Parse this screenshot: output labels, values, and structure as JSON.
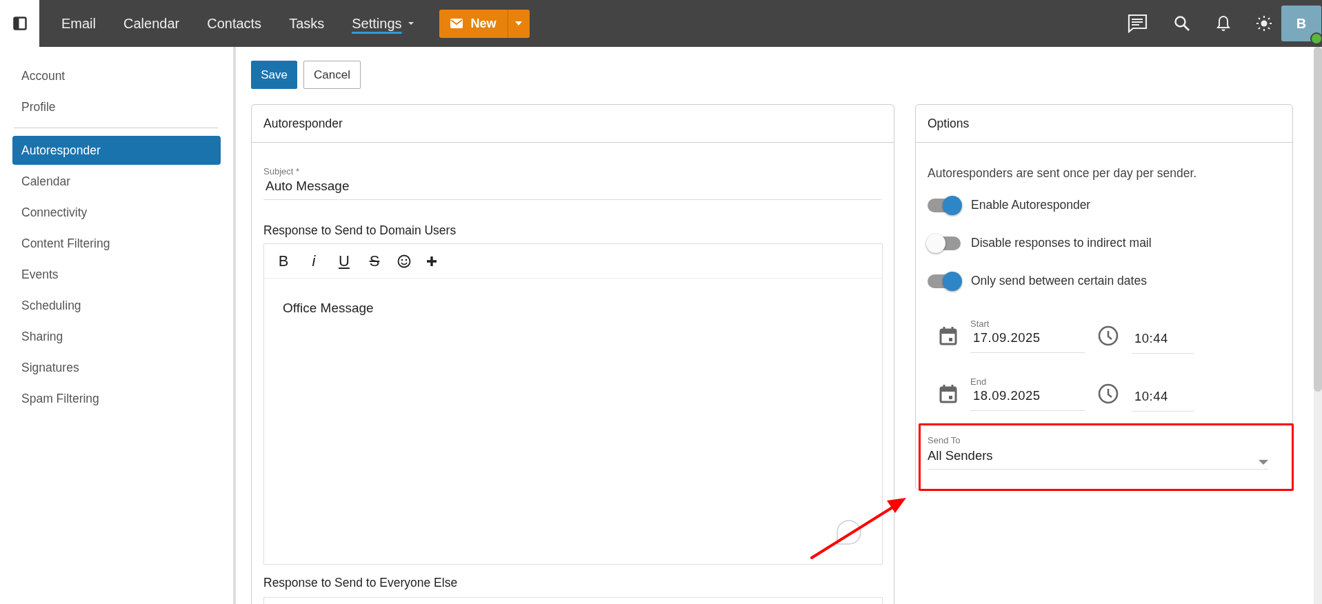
{
  "topbar": {
    "nav": [
      {
        "label": "Email",
        "selected": false
      },
      {
        "label": "Calendar",
        "selected": false
      },
      {
        "label": "Contacts",
        "selected": false
      },
      {
        "label": "Tasks",
        "selected": false
      },
      {
        "label": "Settings",
        "selected": true,
        "dropdown": true
      }
    ],
    "new_button": "New",
    "avatar": "B"
  },
  "sidebar": {
    "items": [
      {
        "label": "Account",
        "selected": false
      },
      {
        "label": "Profile",
        "selected": false
      },
      {
        "label": "Autoresponder",
        "selected": true,
        "divider_before": true
      },
      {
        "label": "Calendar",
        "selected": false
      },
      {
        "label": "Connectivity",
        "selected": false
      },
      {
        "label": "Content Filtering",
        "selected": false
      },
      {
        "label": "Events",
        "selected": false
      },
      {
        "label": "Scheduling",
        "selected": false
      },
      {
        "label": "Sharing",
        "selected": false
      },
      {
        "label": "Signatures",
        "selected": false
      },
      {
        "label": "Spam Filtering",
        "selected": false
      }
    ]
  },
  "actions": [
    "Save",
    "Cancel"
  ],
  "autoresponder": {
    "title": "Autoresponder",
    "subject": {
      "label": "Subject *",
      "value": "Auto Message"
    },
    "domain_response": {
      "label": "Response to Send to Domain Users",
      "toolbar": [
        {
          "kind": "bold",
          "label": "B"
        },
        {
          "kind": "italic",
          "label": "i"
        },
        {
          "kind": "underline",
          "label": "U"
        },
        {
          "kind": "strike",
          "label": "S"
        },
        {
          "kind": "emoji"
        },
        {
          "kind": "plus"
        }
      ],
      "body": "Office Message"
    },
    "everyone_response": {
      "label": "Response to Send to Everyone Else"
    }
  },
  "options": {
    "title": "Options",
    "note": "Autoresponders are sent once per day per sender.",
    "toggles": [
      {
        "label": "Enable Autoresponder",
        "on": true
      },
      {
        "label": "Disable responses to indirect mail",
        "on": false
      },
      {
        "label": "Only send between certain dates",
        "on": true
      }
    ],
    "dates": [
      {
        "label": "Start",
        "date": "17.09.2025",
        "time": "10:44"
      },
      {
        "label": "End",
        "date": "18.09.2025",
        "time": "10:44"
      }
    ],
    "send_to": {
      "label": "Send To",
      "value": "All Senders"
    }
  }
}
